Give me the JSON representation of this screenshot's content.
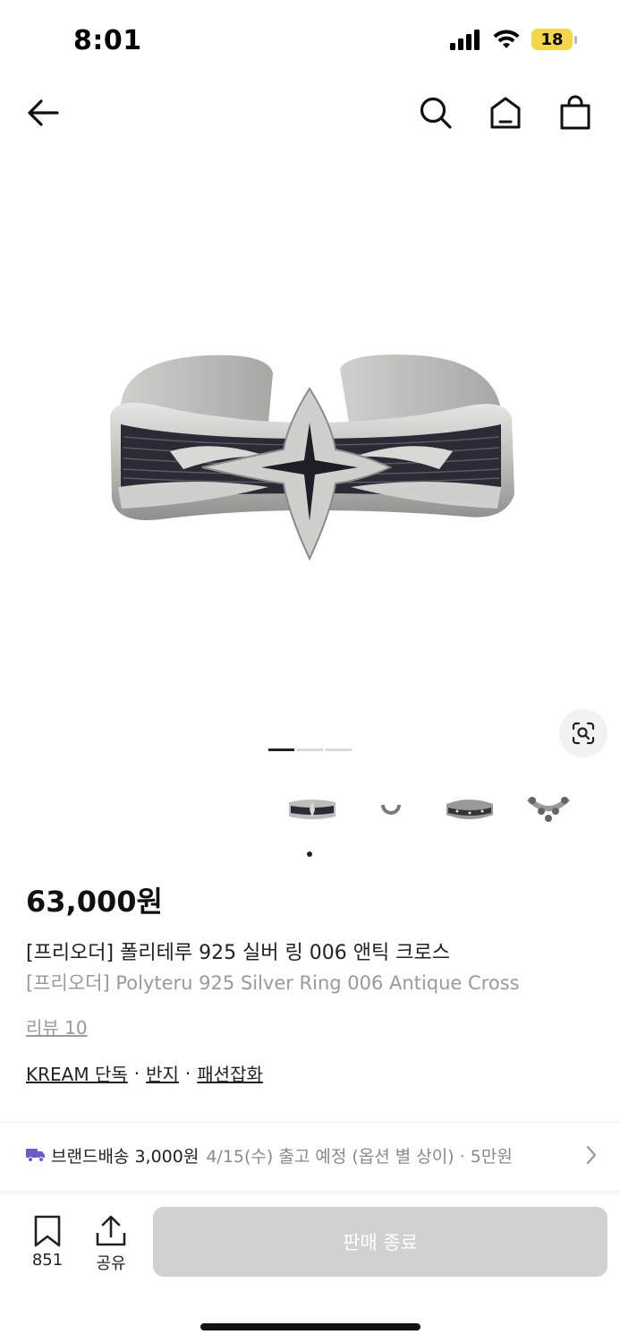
{
  "status_bar": {
    "time": "8:01",
    "battery_level": "18",
    "icons": [
      "cellular-signal-icon",
      "wifi-icon",
      "battery-icon"
    ]
  },
  "nav": {
    "icons": [
      "back-arrow-icon",
      "search-icon",
      "home-icon",
      "shopping-bag-icon"
    ]
  },
  "gallery": {
    "image": "silver-ring-antique-cross",
    "page_count": 3,
    "current_page": 1,
    "thumbnails": [
      "ring-cross-thumb",
      "ring-small-thumb",
      "ring-band-thumb",
      "ring-ornate-thumb",
      "ring-partial-thumb"
    ],
    "selected_thumbnail": 1
  },
  "product": {
    "price": "63,000원",
    "title_ko": "[프리오더] 폴리테루 925 실버 링 006 앤틱 크로스",
    "title_en": "[프리오더] Polyteru 925 Silver Ring 006 Antique Cross",
    "review": "리뷰 10",
    "tags": [
      "KREAM 단독",
      "반지",
      "패션잡화"
    ],
    "tag_separator": "·"
  },
  "delivery": {
    "label": "브랜드배송 3,000원",
    "detail": "4/15(수) 출고 예정 (옵션 별 상이) · 5만원",
    "icon": "truck-icon",
    "icon_color": "#6a5acd"
  },
  "bottom_bar": {
    "wish_count": "851",
    "share_label": "공유",
    "buy_button_label": "판매 종료"
  },
  "colors": {
    "text_primary": "#222222",
    "text_secondary": "#9a9a9a",
    "disabled_button": "#d1d1d1",
    "accent_truck": "#6a5acd"
  }
}
